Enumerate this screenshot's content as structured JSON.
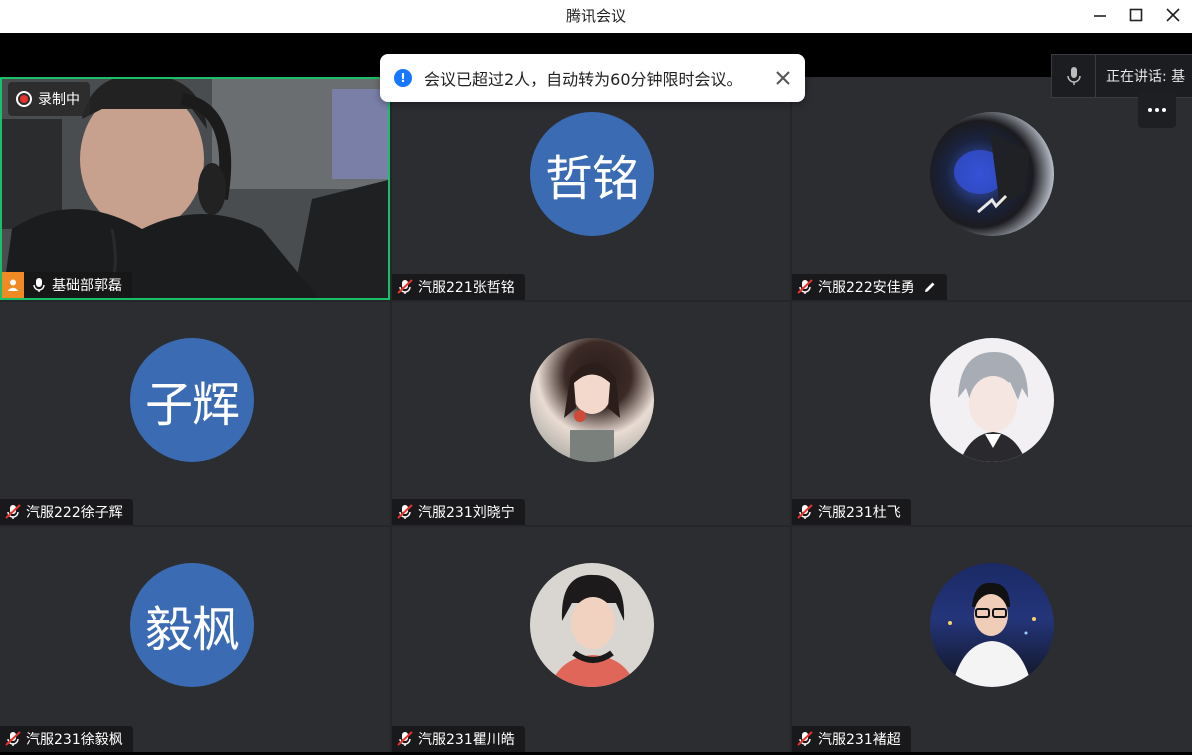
{
  "window": {
    "title": "腾讯会议",
    "controls": [
      "minimize",
      "maximize",
      "close"
    ]
  },
  "recording": {
    "label": "录制中"
  },
  "toast": {
    "message": "会议已超过2人，自动转为60分钟限时会议。"
  },
  "speaking": {
    "label": "正在讲话:  基"
  },
  "participants": [
    {
      "name": "基础部郭磊",
      "type": "video",
      "mic": "on",
      "host": true
    },
    {
      "name": "汽服221张哲铭",
      "avatar_text": "哲铭",
      "mic": "muted"
    },
    {
      "name": "汽服222安佳勇",
      "avatar_icon": "robot-photo-avatar",
      "mic": "muted",
      "editing": true
    },
    {
      "name": "汽服222徐子辉",
      "avatar_text": "子辉",
      "mic": "muted"
    },
    {
      "name": "汽服231刘晓宁",
      "avatar_icon": "girl-photo-avatar",
      "mic": "muted"
    },
    {
      "name": "汽服231杜飞",
      "avatar_icon": "anime-photo-avatar",
      "mic": "muted"
    },
    {
      "name": "汽服231徐毅枫",
      "avatar_text": "毅枫",
      "mic": "muted"
    },
    {
      "name": "汽服231瞿川皓",
      "avatar_icon": "boy-photo-avatar",
      "mic": "muted"
    },
    {
      "name": "汽服231褚超",
      "avatar_icon": "night-photo-avatar",
      "mic": "muted"
    }
  ],
  "colors": {
    "avatar_bg": "#3b6bb3",
    "active_border": "#18c06a",
    "mute_red": "#e8322d",
    "accent": "#1677ff"
  }
}
